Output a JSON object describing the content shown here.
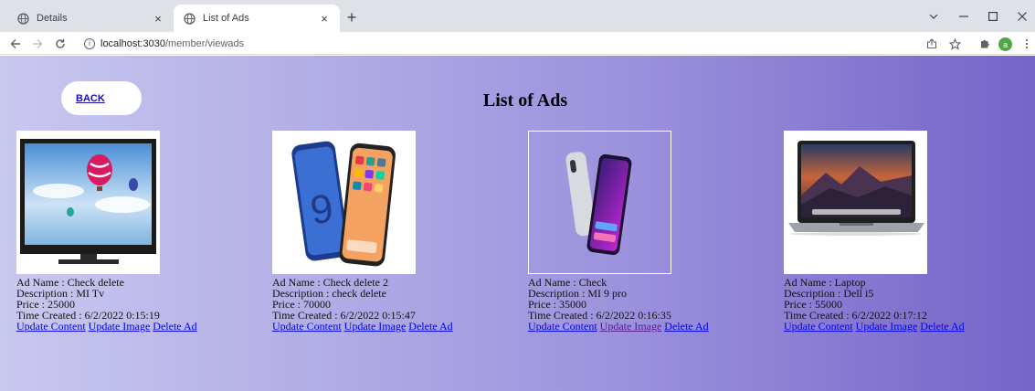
{
  "browser": {
    "tabs": [
      {
        "title": "Details",
        "close": "×"
      },
      {
        "title": "List of Ads",
        "close": "×"
      }
    ],
    "new_tab": "+",
    "window_controls": {
      "minimize_icon": "minimize",
      "maximize_icon": "maximize",
      "close_icon": "close",
      "tab_search_icon": "chevron-down"
    },
    "url_host": "localhost:3030",
    "url_path": "/member/viewads",
    "profile_initial": "a"
  },
  "page": {
    "back_label": "BACK",
    "title": "List of Ads",
    "ads": [
      {
        "image_icon": "tv-image",
        "name": "Ad Name : Check delete",
        "description": "Description : MI Tv",
        "price": "Price : 25000",
        "time": "Time Created : 6/2/2022 0:15:19",
        "links": [
          "Update Content",
          "Update Image",
          "Delete Ad"
        ]
      },
      {
        "image_icon": "phones-image",
        "name": "Ad Name : Check delete 2",
        "description": "Description : check delete",
        "price": "Price : 70000",
        "time": "Time Created : 6/2/2022 0:15:47",
        "links": [
          "Update Content",
          "Update Image",
          "Delete Ad"
        ]
      },
      {
        "image_icon": "phone-image",
        "name": "Ad Name : Check",
        "description": "Description : MI 9 pro",
        "price": "Price : 35000",
        "time": "Time Created : 6/2/2022 0:16:35",
        "links": [
          "Update Content",
          "Update Image",
          "Delete Ad"
        ]
      },
      {
        "image_icon": "laptop-image",
        "name": "Ad Name : Laptop",
        "description": "Description : Dell i5",
        "price": "Price : 55000",
        "time": "Time Created : 6/2/2022 0:17:12",
        "links": [
          "Update Content",
          "Update Image",
          "Delete Ad"
        ]
      }
    ]
  },
  "colors": {
    "link": "#0000ee",
    "visited_link": "#551a8b",
    "gradient_start": "#c9c8ef",
    "gradient_end": "#7664c9"
  }
}
